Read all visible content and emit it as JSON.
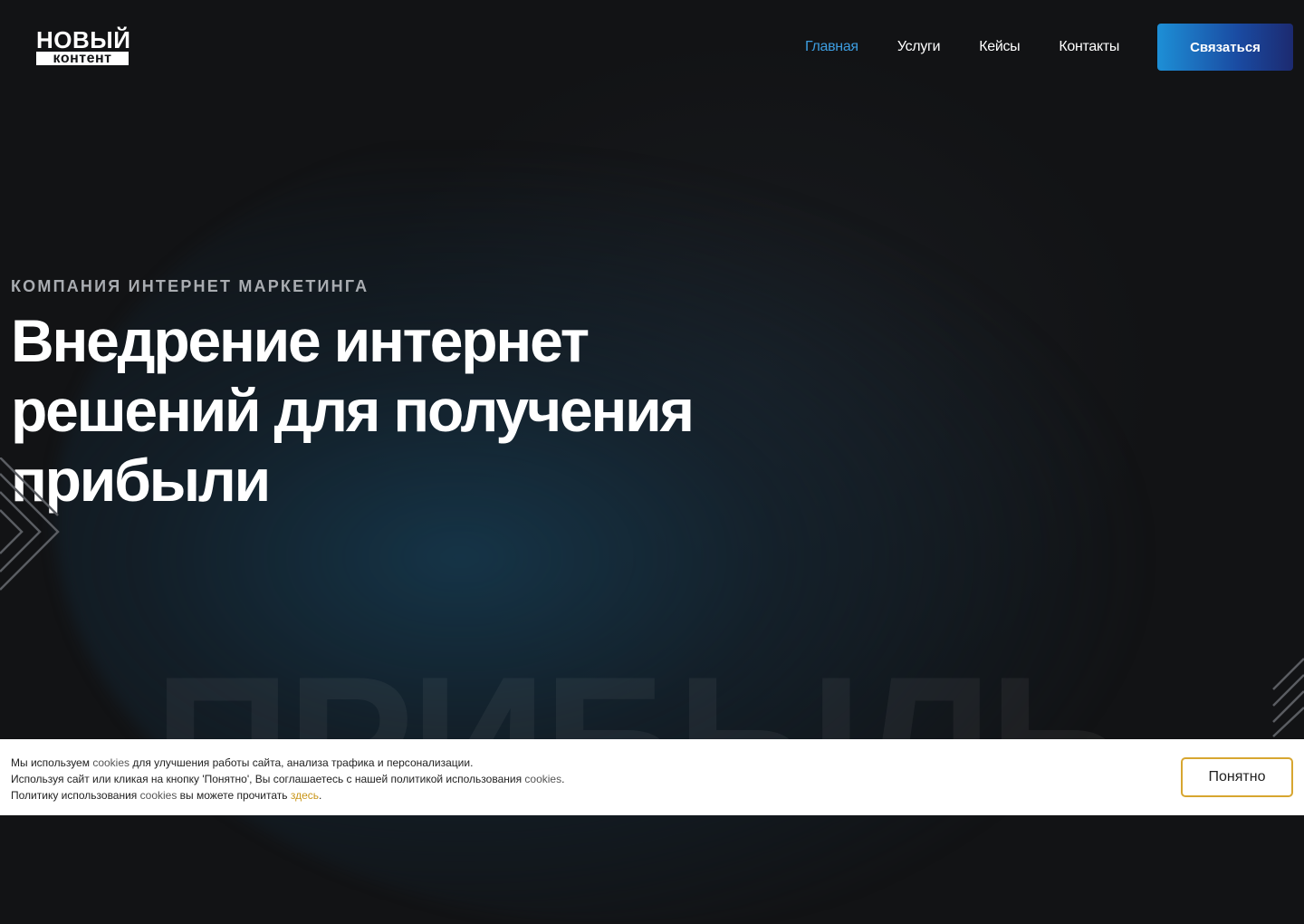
{
  "header": {
    "logo_top": "НОВЫЙ",
    "logo_bottom": "контент",
    "nav": [
      {
        "label": "Главная",
        "active": true
      },
      {
        "label": "Услуги",
        "active": false
      },
      {
        "label": "Кейсы",
        "active": false
      },
      {
        "label": "Контакты",
        "active": false
      }
    ],
    "contact_button": "Связаться"
  },
  "hero": {
    "subtitle": "КОМПАНИЯ ИНТЕРНЕТ МАРКЕТИНГА",
    "title_lines": [
      "Внедрение интернет",
      "решений для получения",
      "прибыли"
    ],
    "watermark": "ПРИБЫЛЬ"
  },
  "cookie": {
    "line1_a": "Мы используем ",
    "line1_kw": "cookies",
    "line1_b": " для улучшения работы сайта, анализа трафика и персонализации.",
    "line2_a": "Используя сайт или кликая на кнопку 'Понятно', Вы соглашаетесь с нашей политикой использования ",
    "line2_kw": "cookies",
    "line2_b": ".",
    "line3_a": "Политику использования ",
    "line3_kw": "cookies",
    "line3_b": " вы можете прочитать ",
    "line3_link": "здесь",
    "line3_c": ".",
    "ok_button": "Понятно"
  },
  "colors": {
    "background": "#121315",
    "accent_blue": "#3d9de0",
    "button_gradient_start": "#1d8fd6",
    "button_gradient_end": "#1c2a70",
    "cookie_link": "#c9961a",
    "ok_border": "#d7a630"
  },
  "icons": {
    "left_decoration": "chevron-lines-icon",
    "right_decoration": "diagonal-lines-icon"
  }
}
